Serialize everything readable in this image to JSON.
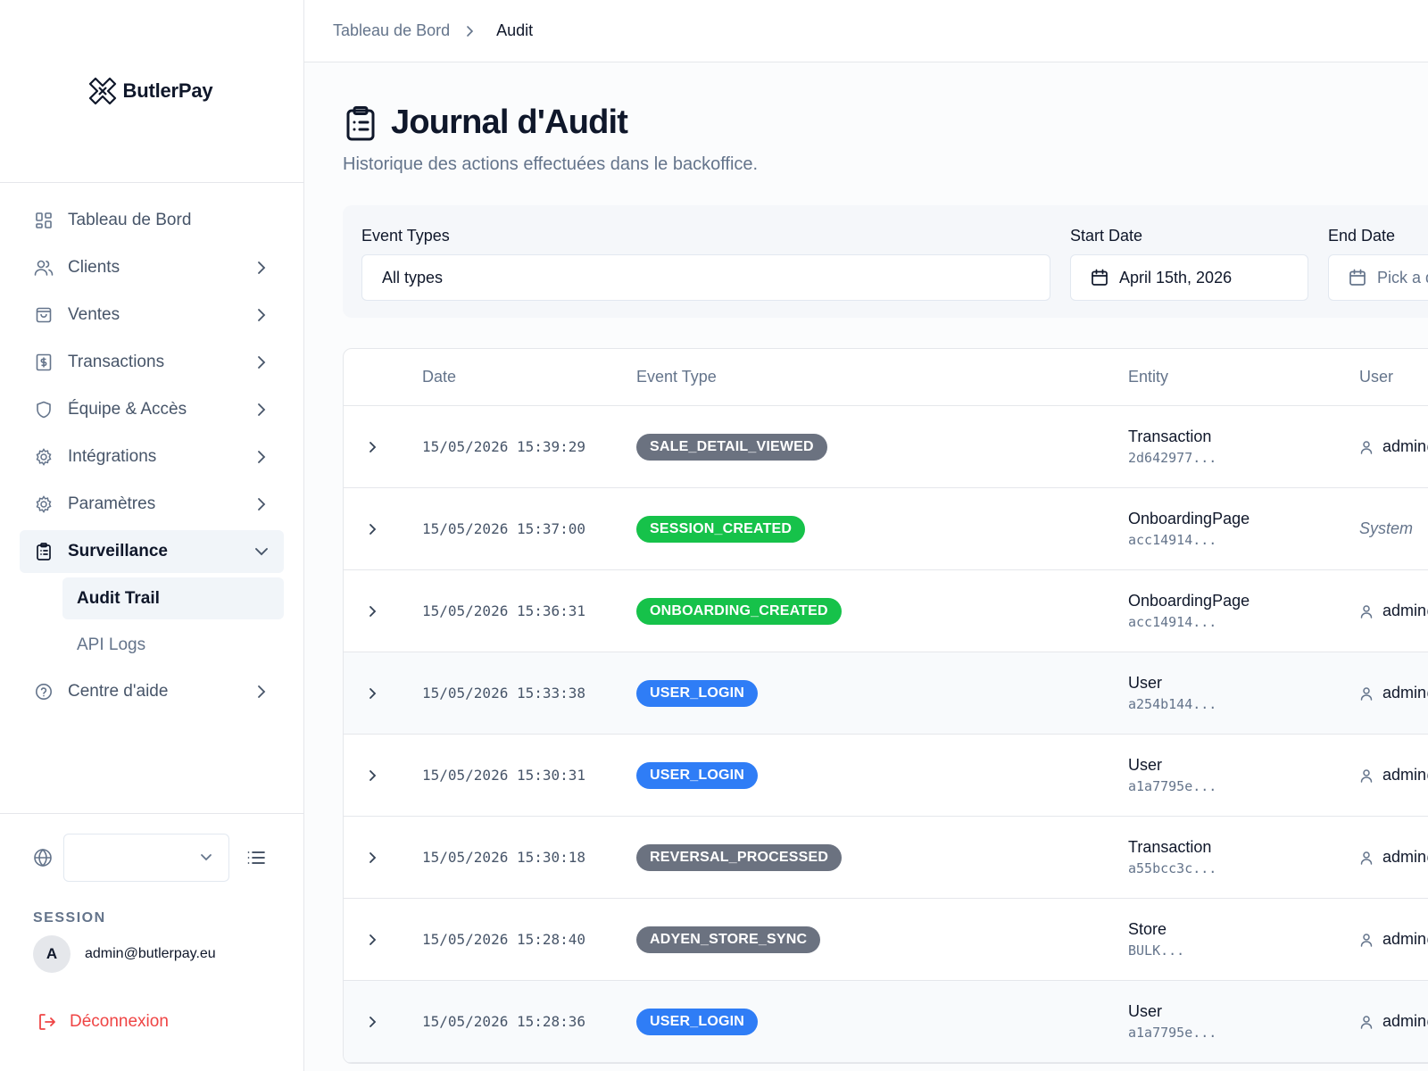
{
  "brand": {
    "name": "ButlerPay"
  },
  "sidebar": {
    "items": [
      {
        "label": "Tableau de Bord",
        "icon": "dashboard-icon",
        "chevron": false,
        "active": false
      },
      {
        "label": "Clients",
        "icon": "users-icon",
        "chevron": true,
        "active": false
      },
      {
        "label": "Ventes",
        "icon": "shopping-bag-icon",
        "chevron": true,
        "active": false
      },
      {
        "label": "Transactions",
        "icon": "receipt-dollar-icon",
        "chevron": true,
        "active": false
      },
      {
        "label": "Équipe & Accès",
        "icon": "shield-icon",
        "chevron": true,
        "active": false
      },
      {
        "label": "Intégrations",
        "icon": "gear-icon",
        "chevron": true,
        "active": false
      },
      {
        "label": "Paramètres",
        "icon": "gear-icon",
        "chevron": true,
        "active": false
      },
      {
        "label": "Surveillance",
        "icon": "clipboard-icon",
        "chevron": true,
        "active": true,
        "expanded": true
      }
    ],
    "sub_items": [
      {
        "label": "Audit Trail",
        "active": true
      },
      {
        "label": "API Logs",
        "active": false
      }
    ],
    "help": {
      "label": "Centre d'aide",
      "icon": "help-circle-icon"
    },
    "language_value": "",
    "session_label": "SESSION",
    "user_initial": "A",
    "user_email": "admin@butlerpay.eu",
    "logout_label": "Déconnexion"
  },
  "breadcrumb": {
    "parent": "Tableau de Bord",
    "current": "Audit"
  },
  "page": {
    "title": "Journal d'Audit",
    "subtitle": "Historique des actions effectuées dans le backoffice."
  },
  "filters": {
    "event_types_label": "Event Types",
    "event_types_value": "All types",
    "start_date_label": "Start Date",
    "start_date_value": "April 15th, 2026",
    "end_date_label": "End Date",
    "end_date_placeholder": "Pick a date"
  },
  "table": {
    "columns": {
      "date": "Date",
      "event_type": "Event Type",
      "entity": "Entity",
      "user": "User"
    },
    "rows": [
      {
        "date": "15/05/2026 15:39:29",
        "event": "SALE_DETAIL_VIEWED",
        "color": "#6b7280",
        "entity": "Transaction",
        "entity_id": "2d642977...",
        "user": "admin@butlerpay.eu",
        "system": false
      },
      {
        "date": "15/05/2026 15:37:00",
        "event": "SESSION_CREATED",
        "color": "#16c24a",
        "entity": "OnboardingPage",
        "entity_id": "acc14914...",
        "user": "System",
        "system": true
      },
      {
        "date": "15/05/2026 15:36:31",
        "event": "ONBOARDING_CREATED",
        "color": "#16c24a",
        "entity": "OnboardingPage",
        "entity_id": "acc14914...",
        "user": "admin@butlerpay.eu",
        "system": false
      },
      {
        "date": "15/05/2026 15:33:38",
        "event": "USER_LOGIN",
        "color": "#2f7df6",
        "entity": "User",
        "entity_id": "a254b144...",
        "user": "admin@butlerpay.eu",
        "system": false
      },
      {
        "date": "15/05/2026 15:30:31",
        "event": "USER_LOGIN",
        "color": "#2f7df6",
        "entity": "User",
        "entity_id": "a1a7795e...",
        "user": "admin@butlerpay.eu",
        "system": false
      },
      {
        "date": "15/05/2026 15:30:18",
        "event": "REVERSAL_PROCESSED",
        "color": "#6b7280",
        "entity": "Transaction",
        "entity_id": "a55bcc3c...",
        "user": "admin@butlerpay.eu",
        "system": false
      },
      {
        "date": "15/05/2026 15:28:40",
        "event": "ADYEN_STORE_SYNC",
        "color": "#6b7280",
        "entity": "Store",
        "entity_id": "BULK...",
        "user": "admin@butlerpay.eu",
        "system": false
      },
      {
        "date": "15/05/2026 15:28:36",
        "event": "USER_LOGIN",
        "color": "#2f7df6",
        "entity": "User",
        "entity_id": "a1a7795e...",
        "user": "admin@butlerpay.eu",
        "system": false
      }
    ]
  }
}
